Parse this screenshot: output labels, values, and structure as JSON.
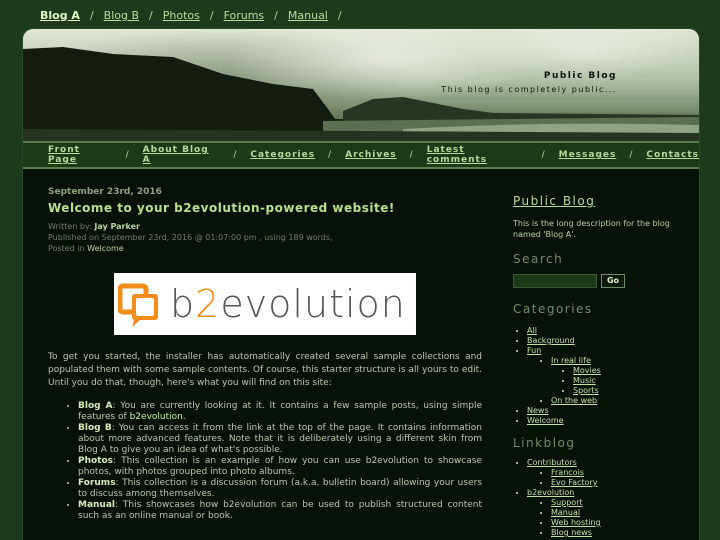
{
  "top_nav": [
    "Blog A",
    "Blog B",
    "Photos",
    "Forums",
    "Manual"
  ],
  "banner": {
    "title": "Public Blog",
    "tagline": "This blog is completely public..."
  },
  "menu": [
    "Front Page",
    "About Blog A",
    "Categories",
    "Archives",
    "Latest comments",
    "Messages",
    "Contacts"
  ],
  "post": {
    "date": "September 23rd, 2016",
    "title": "Welcome to your b2evolution-powered website!",
    "written_by_label": "Written by:",
    "author": "Jay Parker",
    "published": "Published on September 23rd, 2016 @ 01:07:00 pm , using 189 words,",
    "posted_in_label": "Posted in",
    "category": "Welcome",
    "logo_text_a": "b",
    "logo_text_b": "2",
    "logo_text_c": "evolution",
    "intro": "To get you started, the installer has automatically created several sample collections and populated them with some sample contents. Of course, this starter structure is all yours to edit. Until you do that, though, here's what you will find on this site:",
    "features": [
      {
        "name": "Blog A",
        "text": ": You are currently looking at it. It contains a few sample posts, using simple features of ",
        "link": "b2evolution",
        "after": "."
      },
      {
        "name": "Blog B",
        "text": ": You can access it from the link at the top of the page. It contains information about more advanced features. Note that it is deliberately using a different skin from Blog A to give you an idea of what's possible.",
        "link": "",
        "after": ""
      },
      {
        "name": "Photos",
        "text": ": This collection is an example of how you can use b2evolution to showcase photos, with photos grouped into photo albums.",
        "link": "",
        "after": ""
      },
      {
        "name": "Forums",
        "text": ": This collection is a discussion forum (a.k.a. bulletin board) allowing your users to discuss among themselves.",
        "link": "",
        "after": ""
      },
      {
        "name": "Manual",
        "text": ": This showcases how b2evolution can be used to publish structured content such as an online manual or book.",
        "link": "",
        "after": ""
      }
    ]
  },
  "sidebar": {
    "blog_title": "Public Blog",
    "blog_desc": "This is the long description for the blog named 'Blog A'.",
    "search_heading": "Search",
    "search_button": "Go",
    "categories_heading": "Categories",
    "categories": {
      "all": "All",
      "background": "Background",
      "fun": "Fun",
      "in_real_life": "In real life",
      "movies": "Movies",
      "music": "Music",
      "sports": "Sports",
      "on_the_web": "On the web",
      "news": "News",
      "welcome": "Welcome"
    },
    "linkblog_heading": "Linkblog",
    "linkblog": {
      "contributors": "Contributors",
      "francois": "Francois",
      "evo_factory": "Evo Factory",
      "b2evolution": "b2evolution",
      "support": "Support",
      "manual": "Manual",
      "web_hosting": "Web hosting",
      "blog_news": "Blog news"
    }
  }
}
